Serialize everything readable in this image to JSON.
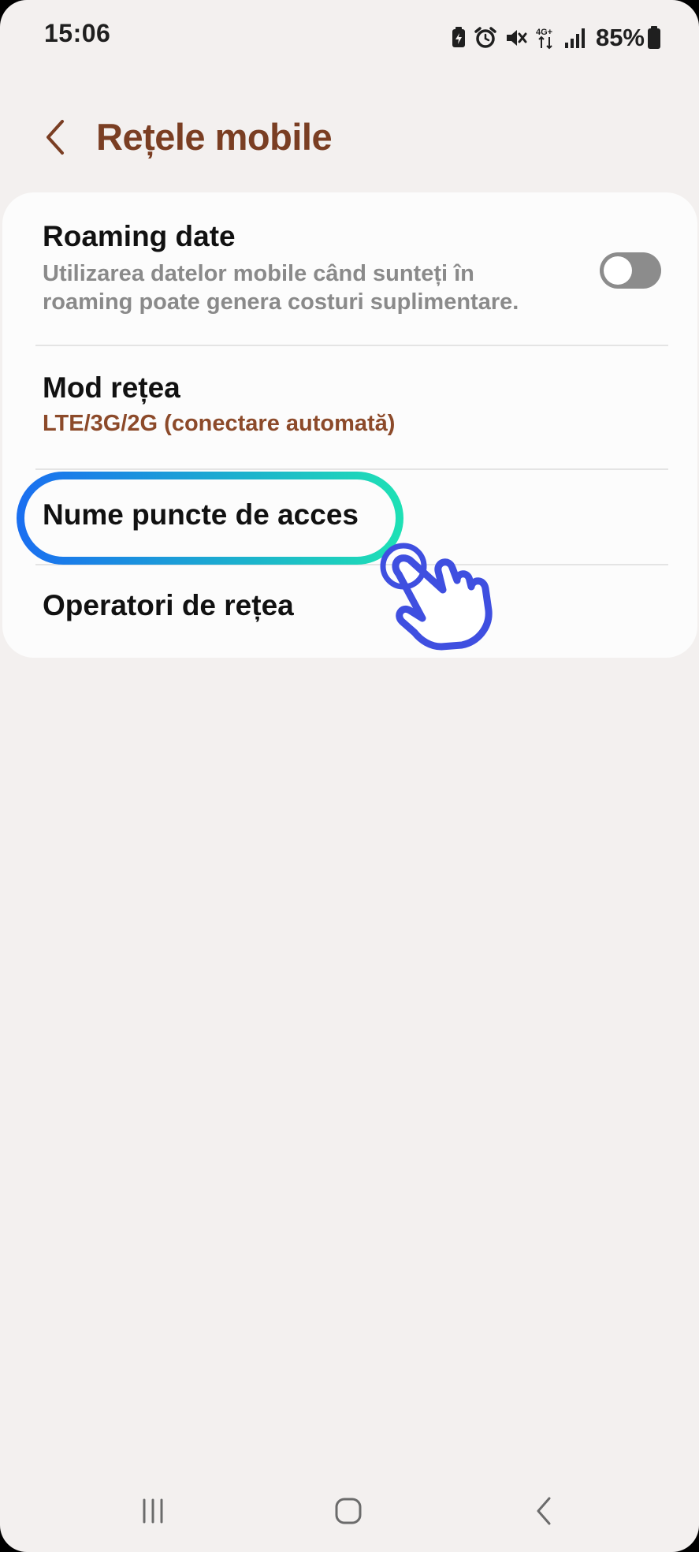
{
  "status_bar": {
    "time": "15:06",
    "battery_percent": "85%",
    "icons": [
      "battery-saver-icon",
      "alarm-icon",
      "mute-icon",
      "4g-plus-data-icon",
      "signal-icon",
      "battery-icon"
    ],
    "network_label": "4G+"
  },
  "header": {
    "back_icon": "chevron-left-icon",
    "title": "Rețele mobile"
  },
  "settings": {
    "roaming": {
      "title": "Roaming date",
      "subtitle_line1": "Utilizarea datelor mobile când sunteți în",
      "subtitle_line2": "roaming poate genera costuri suplimentare.",
      "enabled": false
    },
    "network_mode": {
      "title": "Mod rețea",
      "value": "LTE/3G/2G (conectare automată)"
    },
    "access_point_names": {
      "title": "Nume puncte de acces"
    },
    "network_operators": {
      "title": "Operatori de rețea"
    }
  },
  "annotation": {
    "highlight_colors": [
      "#1a6ff0",
      "#1ee0b5"
    ],
    "hand_color": "#3f4fe0"
  },
  "colors": {
    "background": "#f3f0ef",
    "card": "#fcfcfc",
    "title_accent": "#7a3e23",
    "value_accent": "#8c4a2a"
  },
  "nav_bar": {
    "icons": [
      "recent-apps-icon",
      "home-icon",
      "back-icon"
    ]
  }
}
